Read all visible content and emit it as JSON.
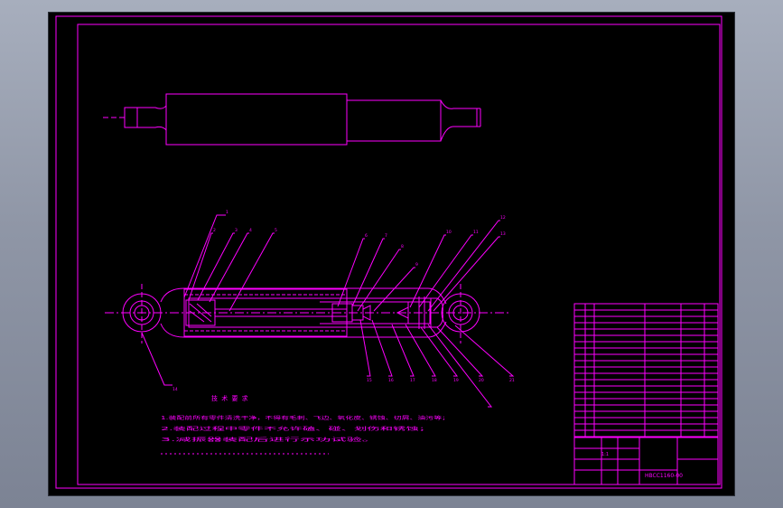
{
  "drawing": {
    "background": "#000000",
    "line_color": "#ff00ff",
    "section_heading": "技 术 要 求",
    "balloon_numbers": [
      "1",
      "2",
      "3",
      "4",
      "5",
      "6",
      "7",
      "8",
      "9",
      "10",
      "11",
      "12",
      "13",
      "14",
      "15",
      "16",
      "17",
      "18",
      "19",
      "20",
      "21"
    ],
    "notes": [
      "1.装配前所有零件清洗干净，不得有毛刺、飞边、氧化皮、锈蚀、切屑、油污等；",
      "2.装配过程中零件不允许磕、碰、划伤和锈蚀；",
      "3.减振器装配后进行示功试验。"
    ],
    "title_block": {
      "designation": "HBCC1160-00",
      "scale_label": "1:1"
    }
  }
}
